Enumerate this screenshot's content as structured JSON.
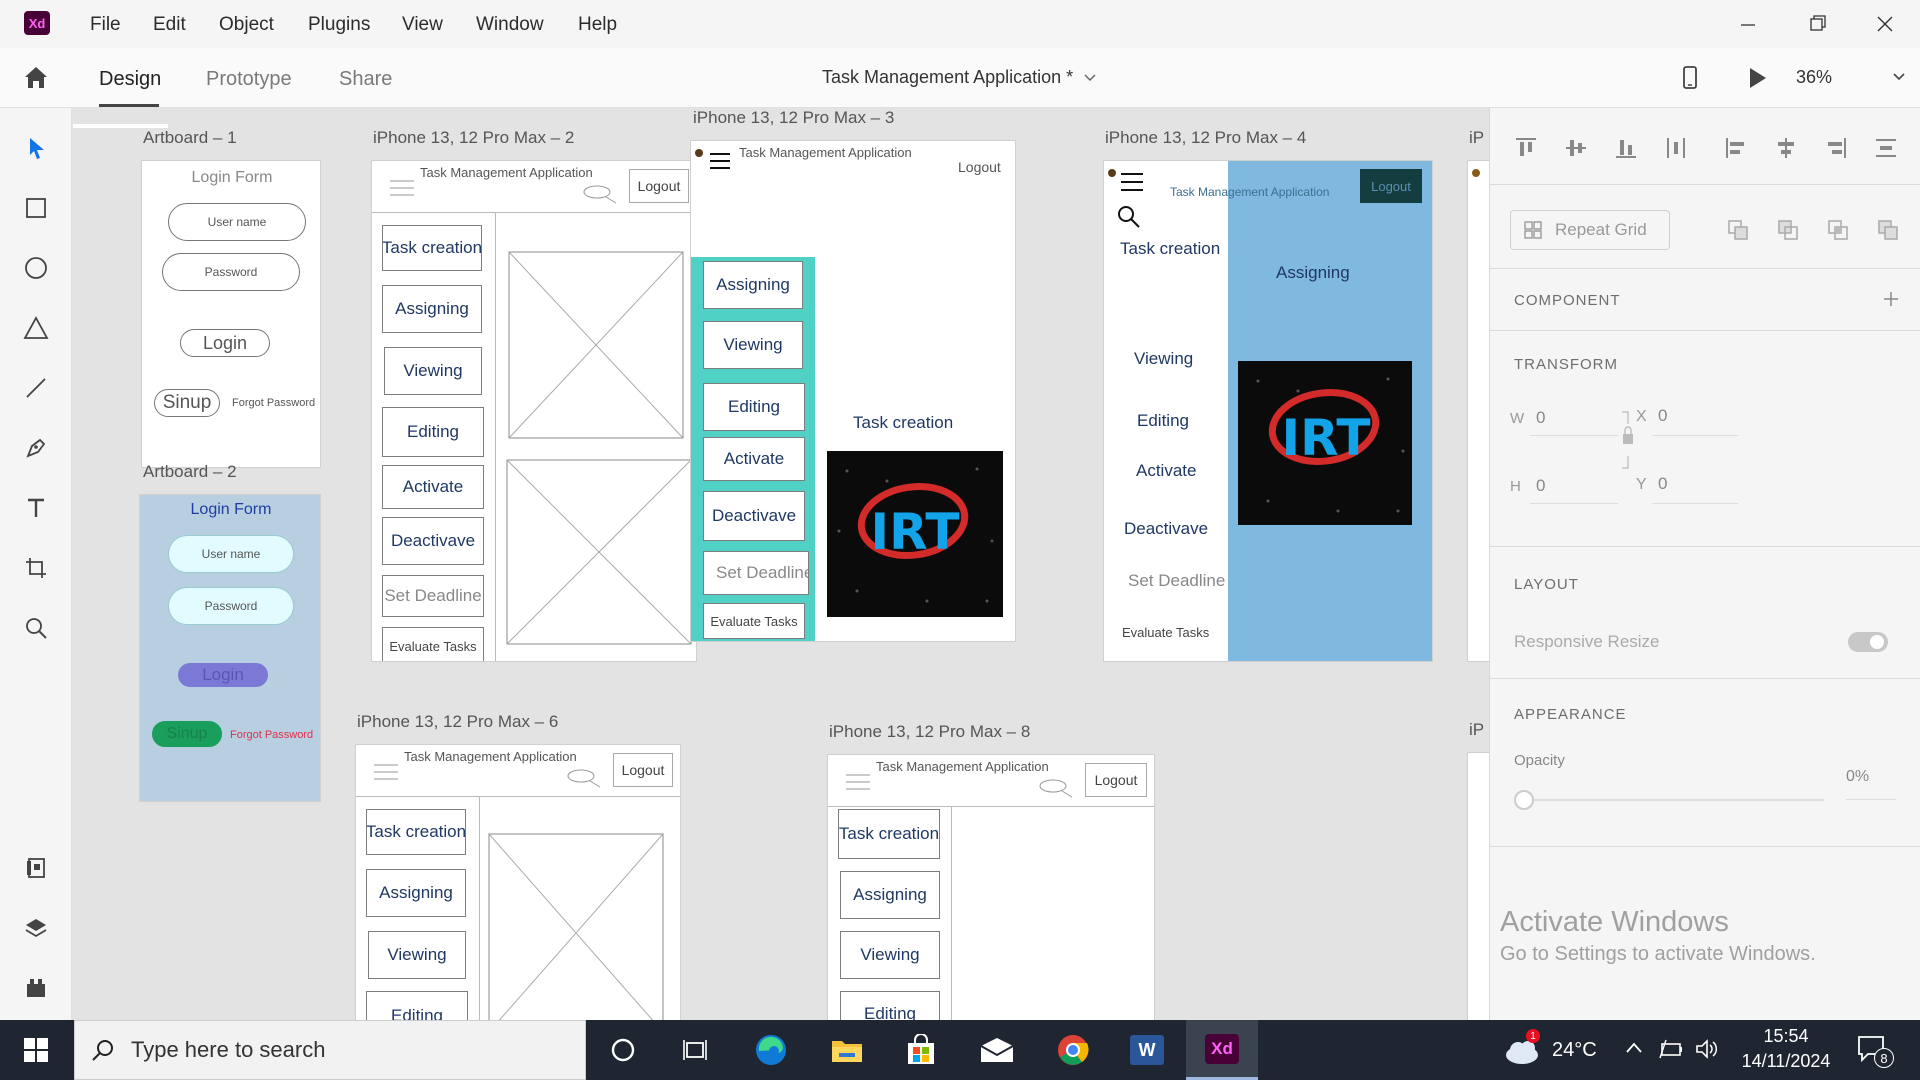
{
  "app": {
    "logo": "Xd",
    "minimize_icon": "minimize-icon",
    "restore_icon": "restore-icon",
    "close_icon": "close-icon"
  },
  "menu": [
    "File",
    "Edit",
    "Object",
    "Plugins",
    "View",
    "Window",
    "Help"
  ],
  "tabs": {
    "design": "Design",
    "prototype": "Prototype",
    "share": "Share",
    "active": "Design"
  },
  "document": {
    "title": "Task Management Application *",
    "zoom": "36%"
  },
  "canvas": {
    "artboard1": {
      "label": "Artboard – 1",
      "title": "Login Form",
      "username": "User name",
      "password": "Password",
      "login": "Login",
      "signup": "Sinup",
      "forgot": "Forgot Password"
    },
    "artboard2": {
      "label": "Artboard – 2",
      "title": "Login Form",
      "username": "User name",
      "password": "Password",
      "login": "Login",
      "signup": "Sinup",
      "forgot": "Forgot Password"
    },
    "iphone2": {
      "label": "iPhone 13, 12 Pro Max – 2",
      "header": "Task Management Application",
      "logout": "Logout",
      "items": [
        "Task creation",
        "Assigning",
        "Viewing",
        "Editing",
        "Activate",
        "Deactivave",
        "Set Deadline",
        "Evaluate Tasks"
      ]
    },
    "iphone3": {
      "label": "iPhone 13, 12 Pro Max – 3",
      "header": "Task Management Application",
      "logout": "Logout",
      "items": [
        "Assigning",
        "Viewing",
        "Editing",
        "Activate",
        "Deactivave",
        "Set Deadline",
        "Evaluate Tasks"
      ],
      "main_label": "Task creation",
      "logo_text": "IRT"
    },
    "iphone4": {
      "label": "iPhone 13, 12 Pro Max – 4",
      "header": "Task Management Application",
      "logout": "Logout",
      "items": [
        "Task creation",
        "Viewing",
        "Editing",
        "Activate",
        "Deactivave",
        "Set Deadline",
        "Evaluate Tasks"
      ],
      "main_label": "Assigning",
      "logo_text": "IRT"
    },
    "iphone6": {
      "label": "iPhone 13, 12 Pro Max – 6",
      "header": "Task Management Application",
      "logout": "Logout",
      "items": [
        "Task creation",
        "Assigning",
        "Viewing",
        "Editing"
      ]
    },
    "iphone8": {
      "label": "iPhone 13, 12 Pro Max – 8",
      "header": "Task Management Application",
      "logout": "Logout",
      "items": [
        "Task creation",
        "Assigning",
        "Viewing",
        "Editing"
      ]
    },
    "partial_label": "iP"
  },
  "panel": {
    "repeat_grid": "Repeat Grid",
    "component": "COMPONENT",
    "transform": "TRANSFORM",
    "w_label": "W",
    "w_value": "0",
    "h_label": "H",
    "h_value": "0",
    "x_label": "X",
    "x_value": "0",
    "y_label": "Y",
    "y_value": "0",
    "layout": "LAYOUT",
    "responsive_resize": "Responsive Resize",
    "appearance": "APPEARANCE",
    "opacity_label": "Opacity",
    "opacity_value": "0%",
    "activate_title": "Activate Windows",
    "activate_sub": "Go to Settings to activate Windows."
  },
  "taskbar": {
    "search_placeholder": "Type here to search",
    "weather": "24°C",
    "weather_badge": "1",
    "time": "15:54",
    "date": "14/11/2024",
    "notification_count": "8",
    "xd_label": "Xd",
    "word_label": "W"
  },
  "colors": {
    "xd_purple": "#470137",
    "xd_pink": "#ff61f6",
    "accent_blue": "#1473e6",
    "teal": "#4fd1c5",
    "sky": "#7fb9df",
    "login_blue": "#b8cfe2"
  }
}
